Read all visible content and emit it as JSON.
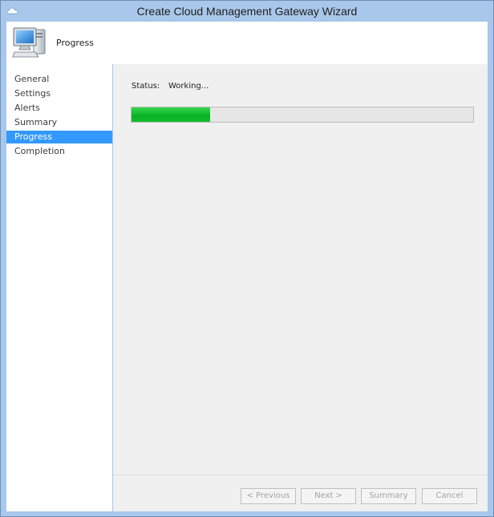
{
  "window": {
    "title": "Create Cloud Management Gateway Wizard"
  },
  "header": {
    "title": "Progress",
    "icon": "computer-icon"
  },
  "sidebar": {
    "items": [
      {
        "label": "General",
        "active": false
      },
      {
        "label": "Settings",
        "active": false
      },
      {
        "label": "Alerts",
        "active": false
      },
      {
        "label": "Summary",
        "active": false
      },
      {
        "label": "Progress",
        "active": true
      },
      {
        "label": "Completion",
        "active": false
      }
    ]
  },
  "main": {
    "status_label": "Status:",
    "status_value": "Working...",
    "progress_fraction": 0.23
  },
  "buttons": {
    "previous": "< Previous",
    "next": "Next >",
    "summary": "Summary",
    "cancel": "Cancel"
  },
  "colors": {
    "accent": "#3399ff",
    "progress": "#06b025",
    "titlebar": "#a9c7ea"
  }
}
